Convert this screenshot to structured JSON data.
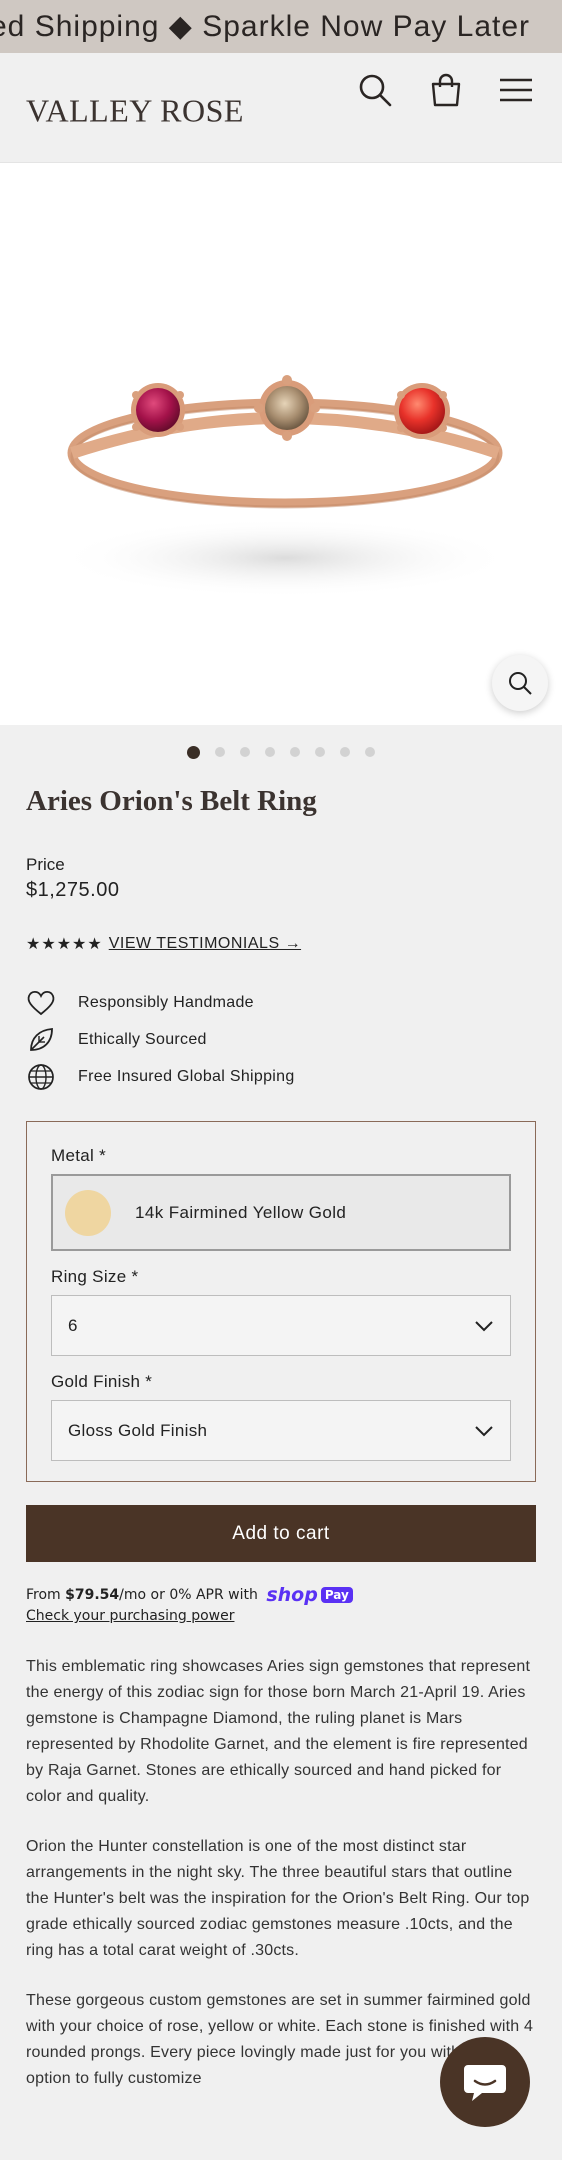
{
  "announcement": "ed Shipping ◆ Sparkle Now Pay Later",
  "header": {
    "logo": "VALLEY ROSE",
    "icons": [
      "search-icon",
      "cart-icon",
      "menu-icon"
    ]
  },
  "gallery": {
    "dot_count": 8,
    "active_dot": 1,
    "zoom_icon": "magnifier-icon"
  },
  "product": {
    "title": "Aries Orion's Belt Ring",
    "price_label": "Price",
    "price": "$1,275.00",
    "stars": "★★★★★",
    "testimonials_link": "VIEW TESTIMONIALS →"
  },
  "features": [
    {
      "icon": "heart-icon",
      "label": "Responsibly Handmade"
    },
    {
      "icon": "leaf-icon",
      "label": "Ethically Sourced"
    },
    {
      "icon": "globe-icon",
      "label": "Free Insured Global Shipping"
    }
  ],
  "options": {
    "metal_label": "Metal *",
    "metal_value": "14k Fairmined Yellow Gold",
    "size_label": "Ring Size *",
    "size_value": "6",
    "finish_label": "Gold Finish *",
    "finish_value": "Gloss Gold Finish"
  },
  "add_to_cart": "Add to cart",
  "shoppay": {
    "prefix": "From ",
    "amount": "$79.54",
    "suffix": "/mo or 0% APR with",
    "brand": "shop",
    "brand_pay": "Pay",
    "check_link": "Check your purchasing power"
  },
  "description": [
    "This emblematic ring showcases Aries sign gemstones that represent the energy of this zodiac sign for those born March 21-April 19. Aries gemstone is Champagne Diamond, the ruling planet is Mars represented by Rhodolite Garnet, and the element is fire represented by Raja Garnet. Stones are ethically sourced and hand picked for color and quality.",
    "Orion the Hunter constellation is one of the most distinct star arrangements in the night sky. The three beautiful stars that outline the Hunter's belt was the inspiration for the Orion's Belt Ring. Our top grade ethically sourced zodiac gemstones measure .10cts, and the ring has a total carat weight of .30cts.",
    "These gorgeous custom gemstones are set in summer fairmined gold with your choice of rose, yellow or white. Each stone is finished with 4 rounded prongs. Every piece lovingly made just for you with the option to fully customize"
  ],
  "colors": {
    "accent": "#4a3426",
    "announcement_bg": "#cfc8c2",
    "shoppay": "#5a31f4"
  }
}
